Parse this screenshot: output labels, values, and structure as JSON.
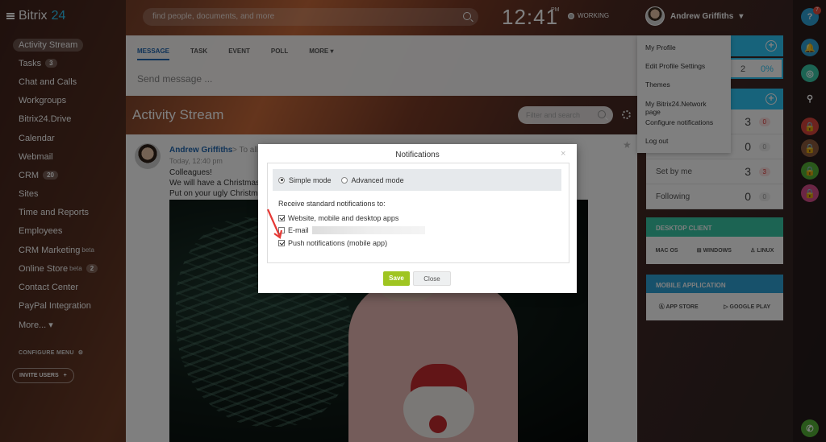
{
  "brand": {
    "name": "Bitrix",
    "version": "24"
  },
  "search": {
    "placeholder": "find people, documents, and more"
  },
  "clock": {
    "time": "12:41",
    "ampm": "PM",
    "status": "WORKING"
  },
  "user": {
    "name": "Andrew Griffiths"
  },
  "sidebar": {
    "items": [
      {
        "label": "Activity Stream"
      },
      {
        "label": "Tasks",
        "badge": "3"
      },
      {
        "label": "Chat and Calls"
      },
      {
        "label": "Workgroups"
      },
      {
        "label": "Bitrix24.Drive"
      },
      {
        "label": "Calendar"
      },
      {
        "label": "Webmail"
      },
      {
        "label": "CRM",
        "badge": "20"
      },
      {
        "label": "Sites"
      },
      {
        "label": "Time and Reports"
      },
      {
        "label": "Employees"
      },
      {
        "label": "CRM Marketing",
        "sup": "beta"
      },
      {
        "label": "Online Store",
        "sup": "beta",
        "badge": "2"
      },
      {
        "label": "Contact Center"
      },
      {
        "label": "PayPal Integration"
      },
      {
        "label": "More... ▾"
      }
    ],
    "configure": "CONFIGURE MENU",
    "invite": "INVITE USERS"
  },
  "composer": {
    "tabs": [
      "MESSAGE",
      "TASK",
      "EVENT",
      "POLL",
      "MORE ▾"
    ],
    "placeholder": "Send message ..."
  },
  "stream": {
    "title": "Activity Stream",
    "filter_placeholder": "Filter and search"
  },
  "post": {
    "author": "Andrew Griffiths",
    "to": "> To all e",
    "time": "Today, 12:40 pm",
    "lines": [
      "Colleagues!",
      "We will have a Christmas p",
      "Put on your ugly Christmas"
    ]
  },
  "user_menu": {
    "items": [
      "My Profile",
      "Edit Profile Settings",
      "Themes",
      "My Bitrix24.Network page",
      "Configure notifications",
      "Log out"
    ]
  },
  "widgets": {
    "tasks_rows": [
      {
        "label": "",
        "count": "3",
        "chip": "0",
        "chip_style": "red"
      },
      {
        "label": "",
        "count": "0",
        "chip": "0",
        "chip_style": "grey"
      },
      {
        "label": "Set by me",
        "count": "3",
        "chip": "3",
        "chip_style": "red"
      },
      {
        "label": "Following",
        "count": "0",
        "chip": "0",
        "chip_style": "grey"
      }
    ],
    "top_values": {
      "a": "2",
      "b": "0%"
    },
    "desktop": {
      "title": "DESKTOP CLIENT",
      "os": [
        "MAC OS",
        "WINDOWS",
        "LINUX"
      ]
    },
    "mobile": {
      "title": "MOBILE APPLICATION",
      "stores": [
        "APP STORE",
        "GOOGLE PLAY"
      ]
    }
  },
  "dialog": {
    "title": "Notifications",
    "close": "×",
    "modes": [
      {
        "label": "Simple mode",
        "selected": true
      },
      {
        "label": "Advanced mode",
        "selected": false
      }
    ],
    "receive_label": "Receive standard notifications to:",
    "options": [
      {
        "label": "Website, mobile and desktop apps",
        "checked": true
      },
      {
        "label": "E-mail",
        "checked": false
      },
      {
        "label": "Push notifications (mobile app)",
        "checked": true
      }
    ],
    "save": "Save",
    "cancel": "Close"
  },
  "rightbar": {
    "help": "?",
    "help_badge": "7"
  },
  "colors": {
    "accent": "#2fc6f6",
    "save": "#9fc521",
    "link": "#2067b0"
  }
}
